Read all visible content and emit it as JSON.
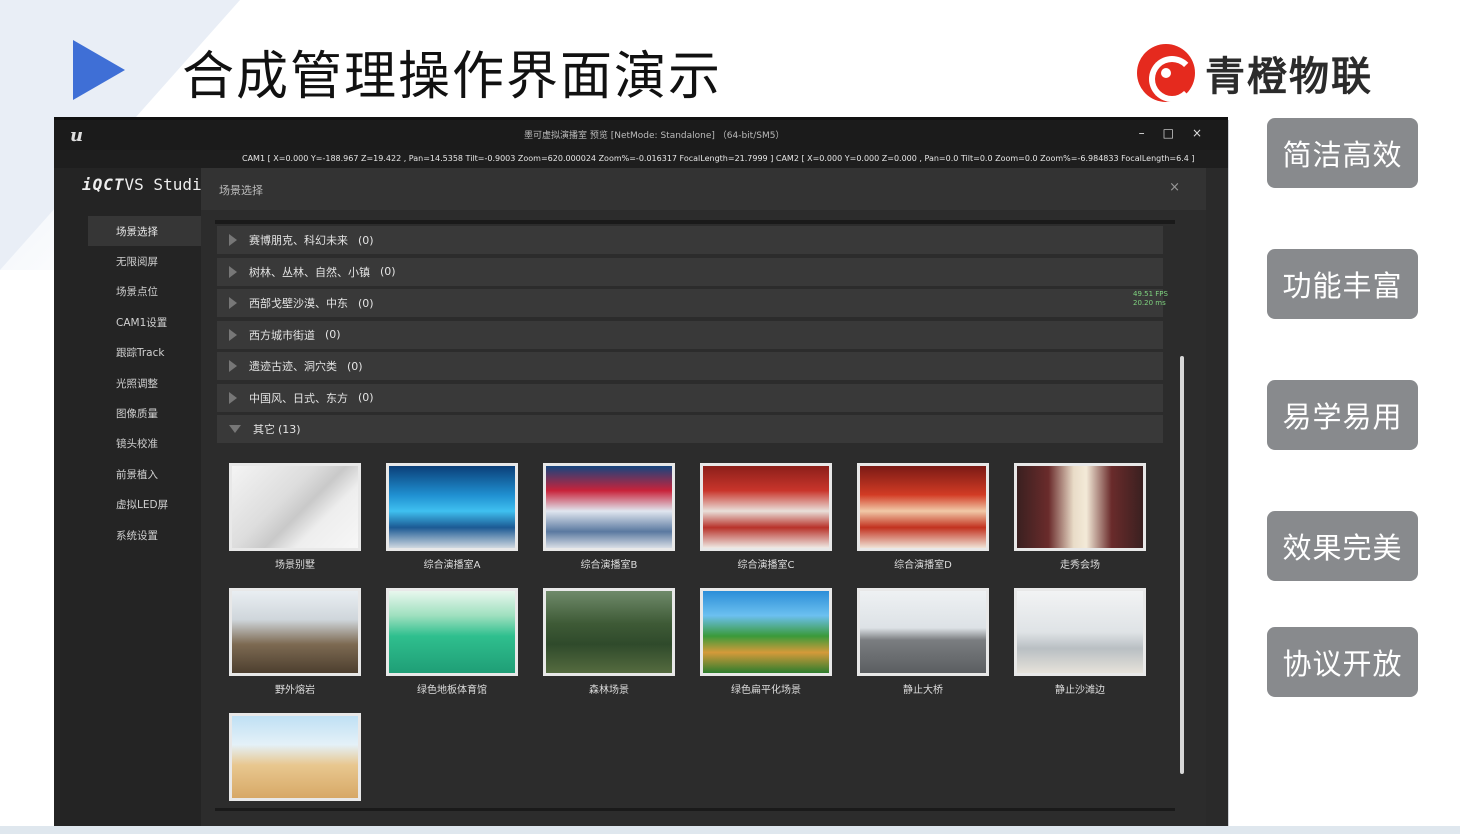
{
  "slide": {
    "title": "合成管理操作界面演示",
    "logo_text": "青橙物联",
    "features": [
      "简洁高效",
      "功能丰富",
      "易学易用",
      "效果完美",
      "协议开放"
    ]
  },
  "app": {
    "ue_logo": "u",
    "window_title": "墨可虚拟演播室 预览 [NetMode: Standalone] （64-bit/SM5）",
    "camline": "CAM1 [ X=0.000 Y=-188.967 Z=19.422 ,  Pan=14.5358  Tilt=-0.9003  Zoom=620.000024  Zoom%=-0.016317  FocalLength=21.7999 ]  CAM2 [ X=0.000 Y=0.000 Z=0.000 ,  Pan=0.0  Tilt=0.0  Zoom=0.0  Zoom%=-6.984833  FocalLength=6.4 ]",
    "window_controls": [
      "–",
      "□",
      "×"
    ],
    "brand_prefix": "iQCT",
    "brand_suffix": "VS Studio",
    "nav": [
      "场景选择",
      "无限阅屏",
      "场景点位",
      "CAM1设置",
      "跟踪Track",
      "光照调整",
      "图像质量",
      "镜头校准",
      "前景植入",
      "虚拟LED屏",
      "系统设置"
    ],
    "panel_title": "场景选择",
    "panel_close": "×",
    "fps": "49.51 FPS",
    "ms": "20.20 ms",
    "categories": [
      {
        "name": "赛博朋克、科幻未来",
        "count": "(0)"
      },
      {
        "name": "树林、丛林、自然、小镇",
        "count": "(0)"
      },
      {
        "name": "西部戈壁沙漠、中东",
        "count": "(0)"
      },
      {
        "name": "西方城市街道",
        "count": "(0)"
      },
      {
        "name": "遗迹古迹、洞穴类",
        "count": "(0)"
      },
      {
        "name": "中国风、日式、东方",
        "count": "(0)"
      },
      {
        "name": "其它",
        "count": "(13)"
      }
    ],
    "thumbnails": [
      "场景别墅",
      "综合演播室A",
      "综合演播室B",
      "综合演播室C",
      "综合演播室D",
      "走秀会场",
      "野外熔岩",
      "绿色地板体育馆",
      "森林场景",
      "绿色扁平化场景",
      "静止大桥",
      "静止沙滩边",
      ""
    ]
  }
}
